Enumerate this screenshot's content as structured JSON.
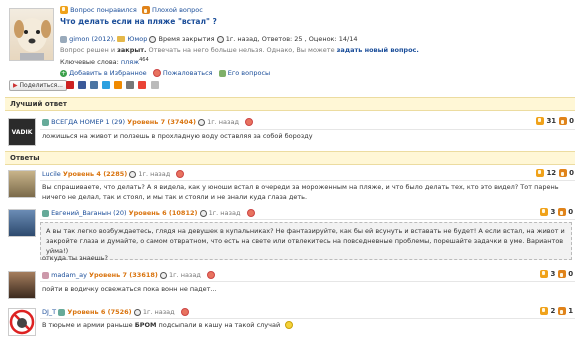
{
  "question": {
    "good_label": "Вопрос понравился",
    "bad_label": "Плохой вопрос",
    "title": "Что делать если на пляже \"встал\" ?",
    "author": "gimon (2012),",
    "category": "Юмор",
    "closed_label": "Время закрытия",
    "ago": "1г. назад,",
    "answers_label": "Ответов: 25 ,",
    "score_label": "Оценок: 14/14",
    "status_prefix": "Вопрос решен и",
    "status_closed": "закрыт.",
    "status_rest": "Отвечать на него больше нельзя. Однако, Вы можете",
    "ask_link": "задать новый вопрос.",
    "keywords_label": "Ключевые слова:",
    "keyword": "пляж",
    "keyword_count": "464",
    "fav_label": "Добавить в Избранное",
    "complain_label": "Пожаловаться",
    "his_q_label": "Его вопросы",
    "share_label": "Поделиться..."
  },
  "best": {
    "section_label": "Лучший ответ",
    "user": "ВСЕГДА НОМЕР 1 (29)",
    "level": "Уровень 7 (37404)",
    "ago": "1г. назад",
    "text": "ложишься на живот и ползешь в прохладную воду оставляя за собой борозду",
    "votes_up": "31",
    "votes_down": "0",
    "avatar_text": "VADIK"
  },
  "answers_section_label": "Ответы",
  "answers": [
    {
      "user": "Lucile",
      "level": "Уровень 4 (2285)",
      "ago": "1г. назад",
      "text": "Вы спрашиваете, что делать? А я видела, как у юноши встал в очереди за мороженным на пляже, и что было делать тех, кто это видел? Тот парень ничего не делал, так и стоял, и мы так и стояли и не знали куда глаза деть.",
      "votes_up": "12",
      "votes_down": "0"
    },
    {
      "user": "Евгений_Baraнын (20)",
      "level": "Уровень 6 (10812)",
      "ago": "1г. назад",
      "quote": "А вы так легко возбуждаетесь, глядя на девушек в купальниках? Не фантазируйте, как бы ей всунуть и вставать не будет! А если встал, на живот и закройте глаза и думайте, о самом отвратном, что есть на свете или отвлекитесь на повседневные проблемы, порешайте задачки в уме. Вариантов уйма!)",
      "text": "откуда ты знаешь?",
      "votes_up": "3",
      "votes_down": "0"
    },
    {
      "user": "madam_ay",
      "level": "Уровень 7 (33618)",
      "ago": "1г. назад",
      "text": "пойти в водичку освежаться пока вонн не падет...",
      "votes_up": "3",
      "votes_down": "0"
    },
    {
      "user": "DJ_T",
      "level": "Уровень 6 (7526)",
      "ago": "1г. назад",
      "text_pre": "В тюрьме и армии раньше",
      "text_bold": "БРОМ",
      "text_post": "подсыпали в кашу на такой случай",
      "votes_up": "2",
      "votes_down": "1"
    }
  ],
  "colors": {
    "link": "#1a4d99",
    "level": "#d9730d",
    "section_bg": "#fff7d6"
  }
}
